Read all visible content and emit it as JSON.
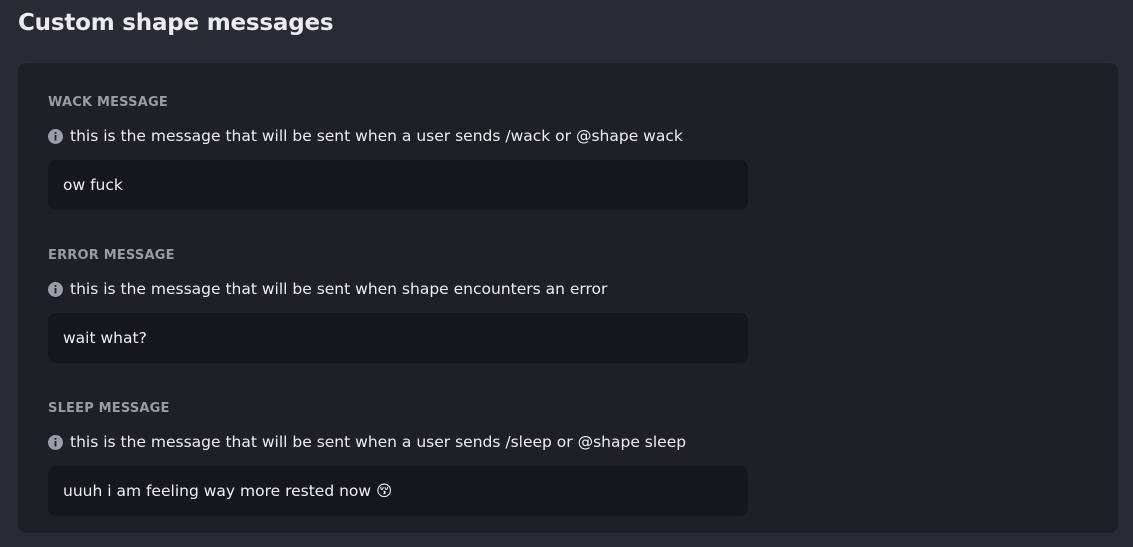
{
  "page": {
    "title": "Custom shape messages"
  },
  "fields": [
    {
      "label": "WACK MESSAGE",
      "help": "this is the message that will be sent when a user sends /wack or @shape wack",
      "value": "ow fuck"
    },
    {
      "label": "ERROR MESSAGE",
      "help": "this is the message that will be sent when shape encounters an error",
      "value": "wait what?"
    },
    {
      "label": "SLEEP MESSAGE",
      "help": "this is the message that will be sent when a user sends /sleep or @shape sleep",
      "value": "uuuh i am feeling way more rested now 😚"
    }
  ],
  "icons": {
    "info": "info-circle-icon"
  },
  "colors": {
    "page_bg": "#2a2a35",
    "panel_bg": "#1f1f28",
    "input_bg": "#16161e",
    "label": "#9b9ba6",
    "text": "#eeeef3"
  }
}
